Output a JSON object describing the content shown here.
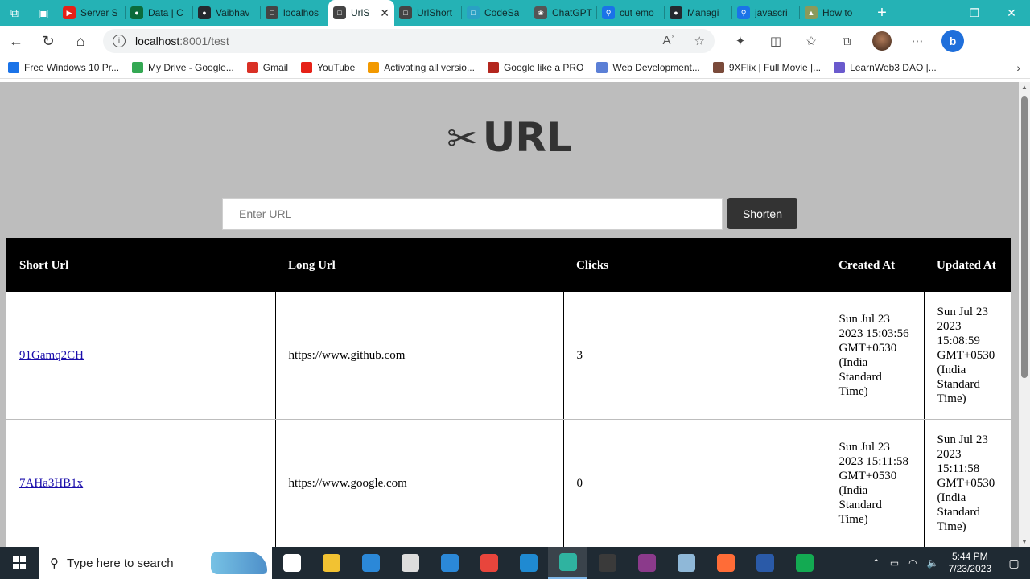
{
  "browser": {
    "tabs": [
      {
        "title": "Server S",
        "favicon_color": "#e62117",
        "favicon": "▶"
      },
      {
        "title": "Data | C",
        "favicon_color": "#0b6b3a",
        "favicon": "●"
      },
      {
        "title": "Vaibhav",
        "favicon_color": "#24292f",
        "favicon": "●"
      },
      {
        "title": "localhos",
        "favicon_color": "#444444",
        "favicon": "□"
      },
      {
        "title": "UrlS",
        "favicon_color": "#444444",
        "favicon": "□",
        "active": true
      },
      {
        "title": "UrlShort",
        "favicon_color": "#444444",
        "favicon": "□"
      },
      {
        "title": "CodeSa",
        "favicon_color": "#2aa1c4",
        "favicon": "□"
      },
      {
        "title": "ChatGPT",
        "favicon_color": "#555555",
        "favicon": "❀"
      },
      {
        "title": "cut emo",
        "favicon_color": "#1a73e8",
        "favicon": "⚲"
      },
      {
        "title": "Managi",
        "favicon_color": "#24292f",
        "favicon": "●"
      },
      {
        "title": "javascri",
        "favicon_color": "#1a73e8",
        "favicon": "⚲"
      },
      {
        "title": "How to",
        "favicon_color": "#8a9a5b",
        "favicon": "▲"
      }
    ],
    "close_tab_glyph": "✕",
    "new_tab_glyph": "+",
    "address": {
      "host": "localhost",
      "path": ":8001/test"
    },
    "bookmarks": [
      {
        "label": "Free Windows 10 Pr...",
        "color": "#1a73e8"
      },
      {
        "label": "My Drive - Google...",
        "color": "#34a853"
      },
      {
        "label": "Gmail",
        "color": "#d93025"
      },
      {
        "label": "YouTube",
        "color": "#e62117"
      },
      {
        "label": "Activating all versio...",
        "color": "#f29900"
      },
      {
        "label": "Google like a PRO",
        "color": "#b3261e"
      },
      {
        "label": "Web Development...",
        "color": "#5b7fd6"
      },
      {
        "label": "9XFlix | Full Movie |...",
        "color": "#7a4a3a"
      },
      {
        "label": "LearnWeb3 DAO |...",
        "color": "#6a5acd"
      }
    ]
  },
  "page": {
    "logo_icon": "✂",
    "logo_text": "URL",
    "url_input": {
      "placeholder": "Enter URL",
      "value": ""
    },
    "shorten_label": "Shorten",
    "table": {
      "headers": [
        "Short Url",
        "Long Url",
        "Clicks",
        "Created At",
        "Updated At"
      ],
      "rows": [
        {
          "short": "91Gamq2CH",
          "long": "https://www.github.com",
          "clicks": "3",
          "created": "Sun Jul 23 2023 15:03:56 GMT+0530 (India Standard Time)",
          "updated": "Sun Jul 23 2023 15:08:59 GMT+0530 (India Standard Time)"
        },
        {
          "short": "7AHa3HB1x",
          "long": "https://www.google.com",
          "clicks": "0",
          "created": "Sun Jul 23 2023 15:11:58 GMT+0530 (India Standard Time)",
          "updated": "Sun Jul 23 2023 15:11:58 GMT+0530 (India Standard Time)"
        }
      ]
    }
  },
  "taskbar": {
    "search_placeholder": "Type here to search",
    "apps": [
      {
        "name": "task-view-icon",
        "color": "#ffffff"
      },
      {
        "name": "file-explorer-icon",
        "color": "#f2c232"
      },
      {
        "name": "microsoft-store-icon",
        "color": "#2b88d8"
      },
      {
        "name": "settings-icon",
        "color": "#dddddd"
      },
      {
        "name": "mail-icon",
        "color": "#2b88d8"
      },
      {
        "name": "chrome-icon",
        "color": "#e8453c"
      },
      {
        "name": "vscode-icon",
        "color": "#1f8ad2"
      },
      {
        "name": "edge-icon",
        "color": "#2fb3a0",
        "active": true
      },
      {
        "name": "terminal-icon",
        "color": "#3a3a3a"
      },
      {
        "name": "winrar-icon",
        "color": "#8b3a8b"
      },
      {
        "name": "notepad-icon",
        "color": "#8fb8d8"
      },
      {
        "name": "postman-icon",
        "color": "#ff6c37"
      },
      {
        "name": "powershell-icon",
        "color": "#2a5aa8"
      },
      {
        "name": "mongodb-compass-icon",
        "color": "#13aa52"
      }
    ],
    "time": "5:44 PM",
    "date": "7/23/2023"
  }
}
